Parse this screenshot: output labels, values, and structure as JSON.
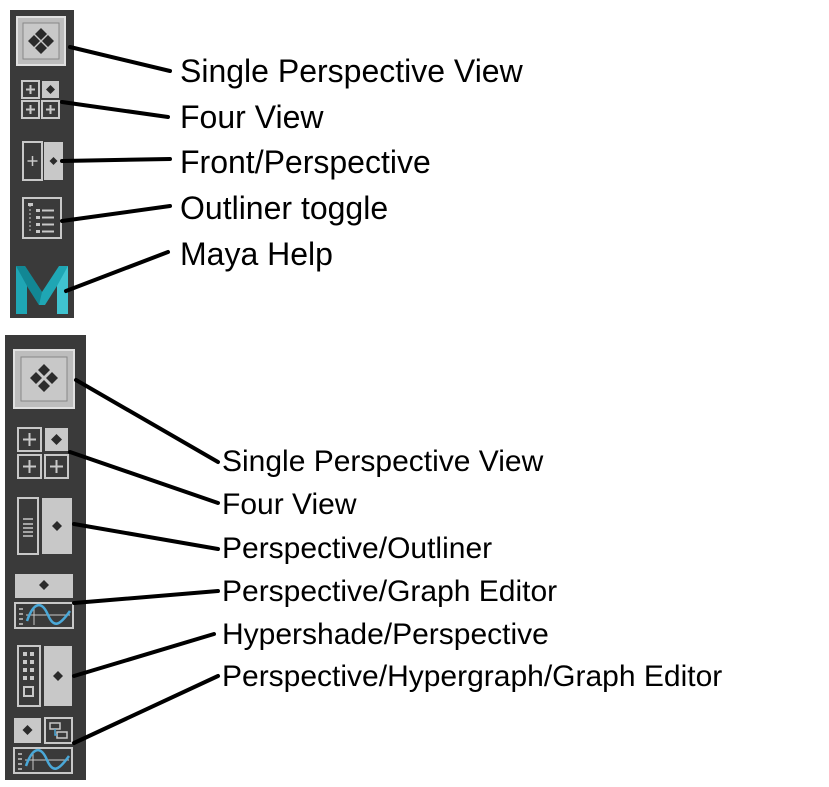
{
  "top_group": {
    "labels": [
      "Single Perspective View",
      "Four View",
      "Front/Perspective",
      "Outliner toggle",
      "Maya Help"
    ],
    "icons": [
      "single-perspective-view-icon",
      "four-view-icon",
      "front-perspective-icon",
      "outliner-toggle-icon",
      "maya-help-icon"
    ]
  },
  "bottom_group": {
    "labels": [
      "Single Perspective View",
      "Four View",
      "Perspective/Outliner",
      "Perspective/Graph Editor",
      "Hypershade/Perspective",
      "Perspective/Hypergraph/Graph Editor"
    ],
    "icons": [
      "single-perspective-view-icon",
      "four-view-icon",
      "perspective-outliner-icon",
      "perspective-graph-editor-icon",
      "hypershade-perspective-icon",
      "perspective-hypergraph-graph-editor-icon"
    ]
  },
  "colors": {
    "panel": "#3a3a3a",
    "icon_light": "#c8c8c8",
    "icon_dark": "#2b2b2b",
    "maya_teal": "#1fa6b4",
    "graph_curve": "#4aa8d8"
  }
}
